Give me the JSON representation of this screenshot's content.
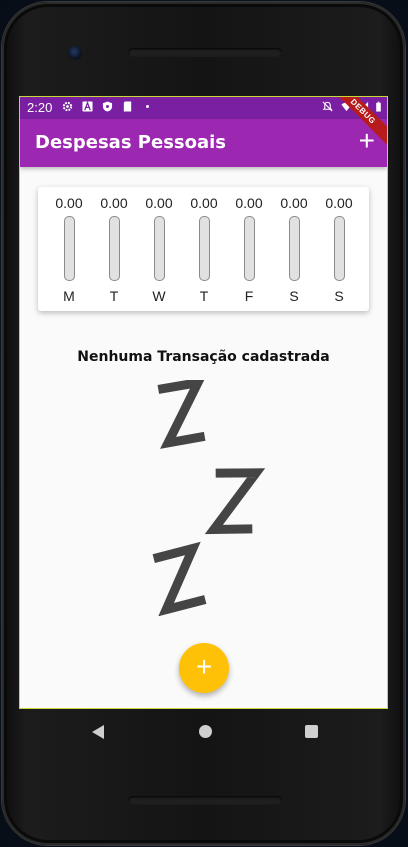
{
  "status_bar": {
    "time": "2:20",
    "debug_banner": "DEBUG"
  },
  "app_bar": {
    "title": "Despesas Pessoais",
    "add_icon": "+"
  },
  "chart": {
    "bars": [
      {
        "day": "M",
        "value": "0.00",
        "fill": 0
      },
      {
        "day": "T",
        "value": "0.00",
        "fill": 0
      },
      {
        "day": "W",
        "value": "0.00",
        "fill": 0
      },
      {
        "day": "T",
        "value": "0.00",
        "fill": 0
      },
      {
        "day": "F",
        "value": "0.00",
        "fill": 0
      },
      {
        "day": "S",
        "value": "0.00",
        "fill": 0
      },
      {
        "day": "S",
        "value": "0.00",
        "fill": 0
      }
    ],
    "fill_color": "#9c27b0"
  },
  "empty_state": {
    "title": "Nenhuma Transação cadastrada",
    "image_icon": "zzz-sleep-icon"
  },
  "fab": {
    "label": "+",
    "color": "#ffc107"
  },
  "colors": {
    "primary": "#9c27b0",
    "primary_dark": "#7b1fa2",
    "accent": "#ffc107"
  }
}
